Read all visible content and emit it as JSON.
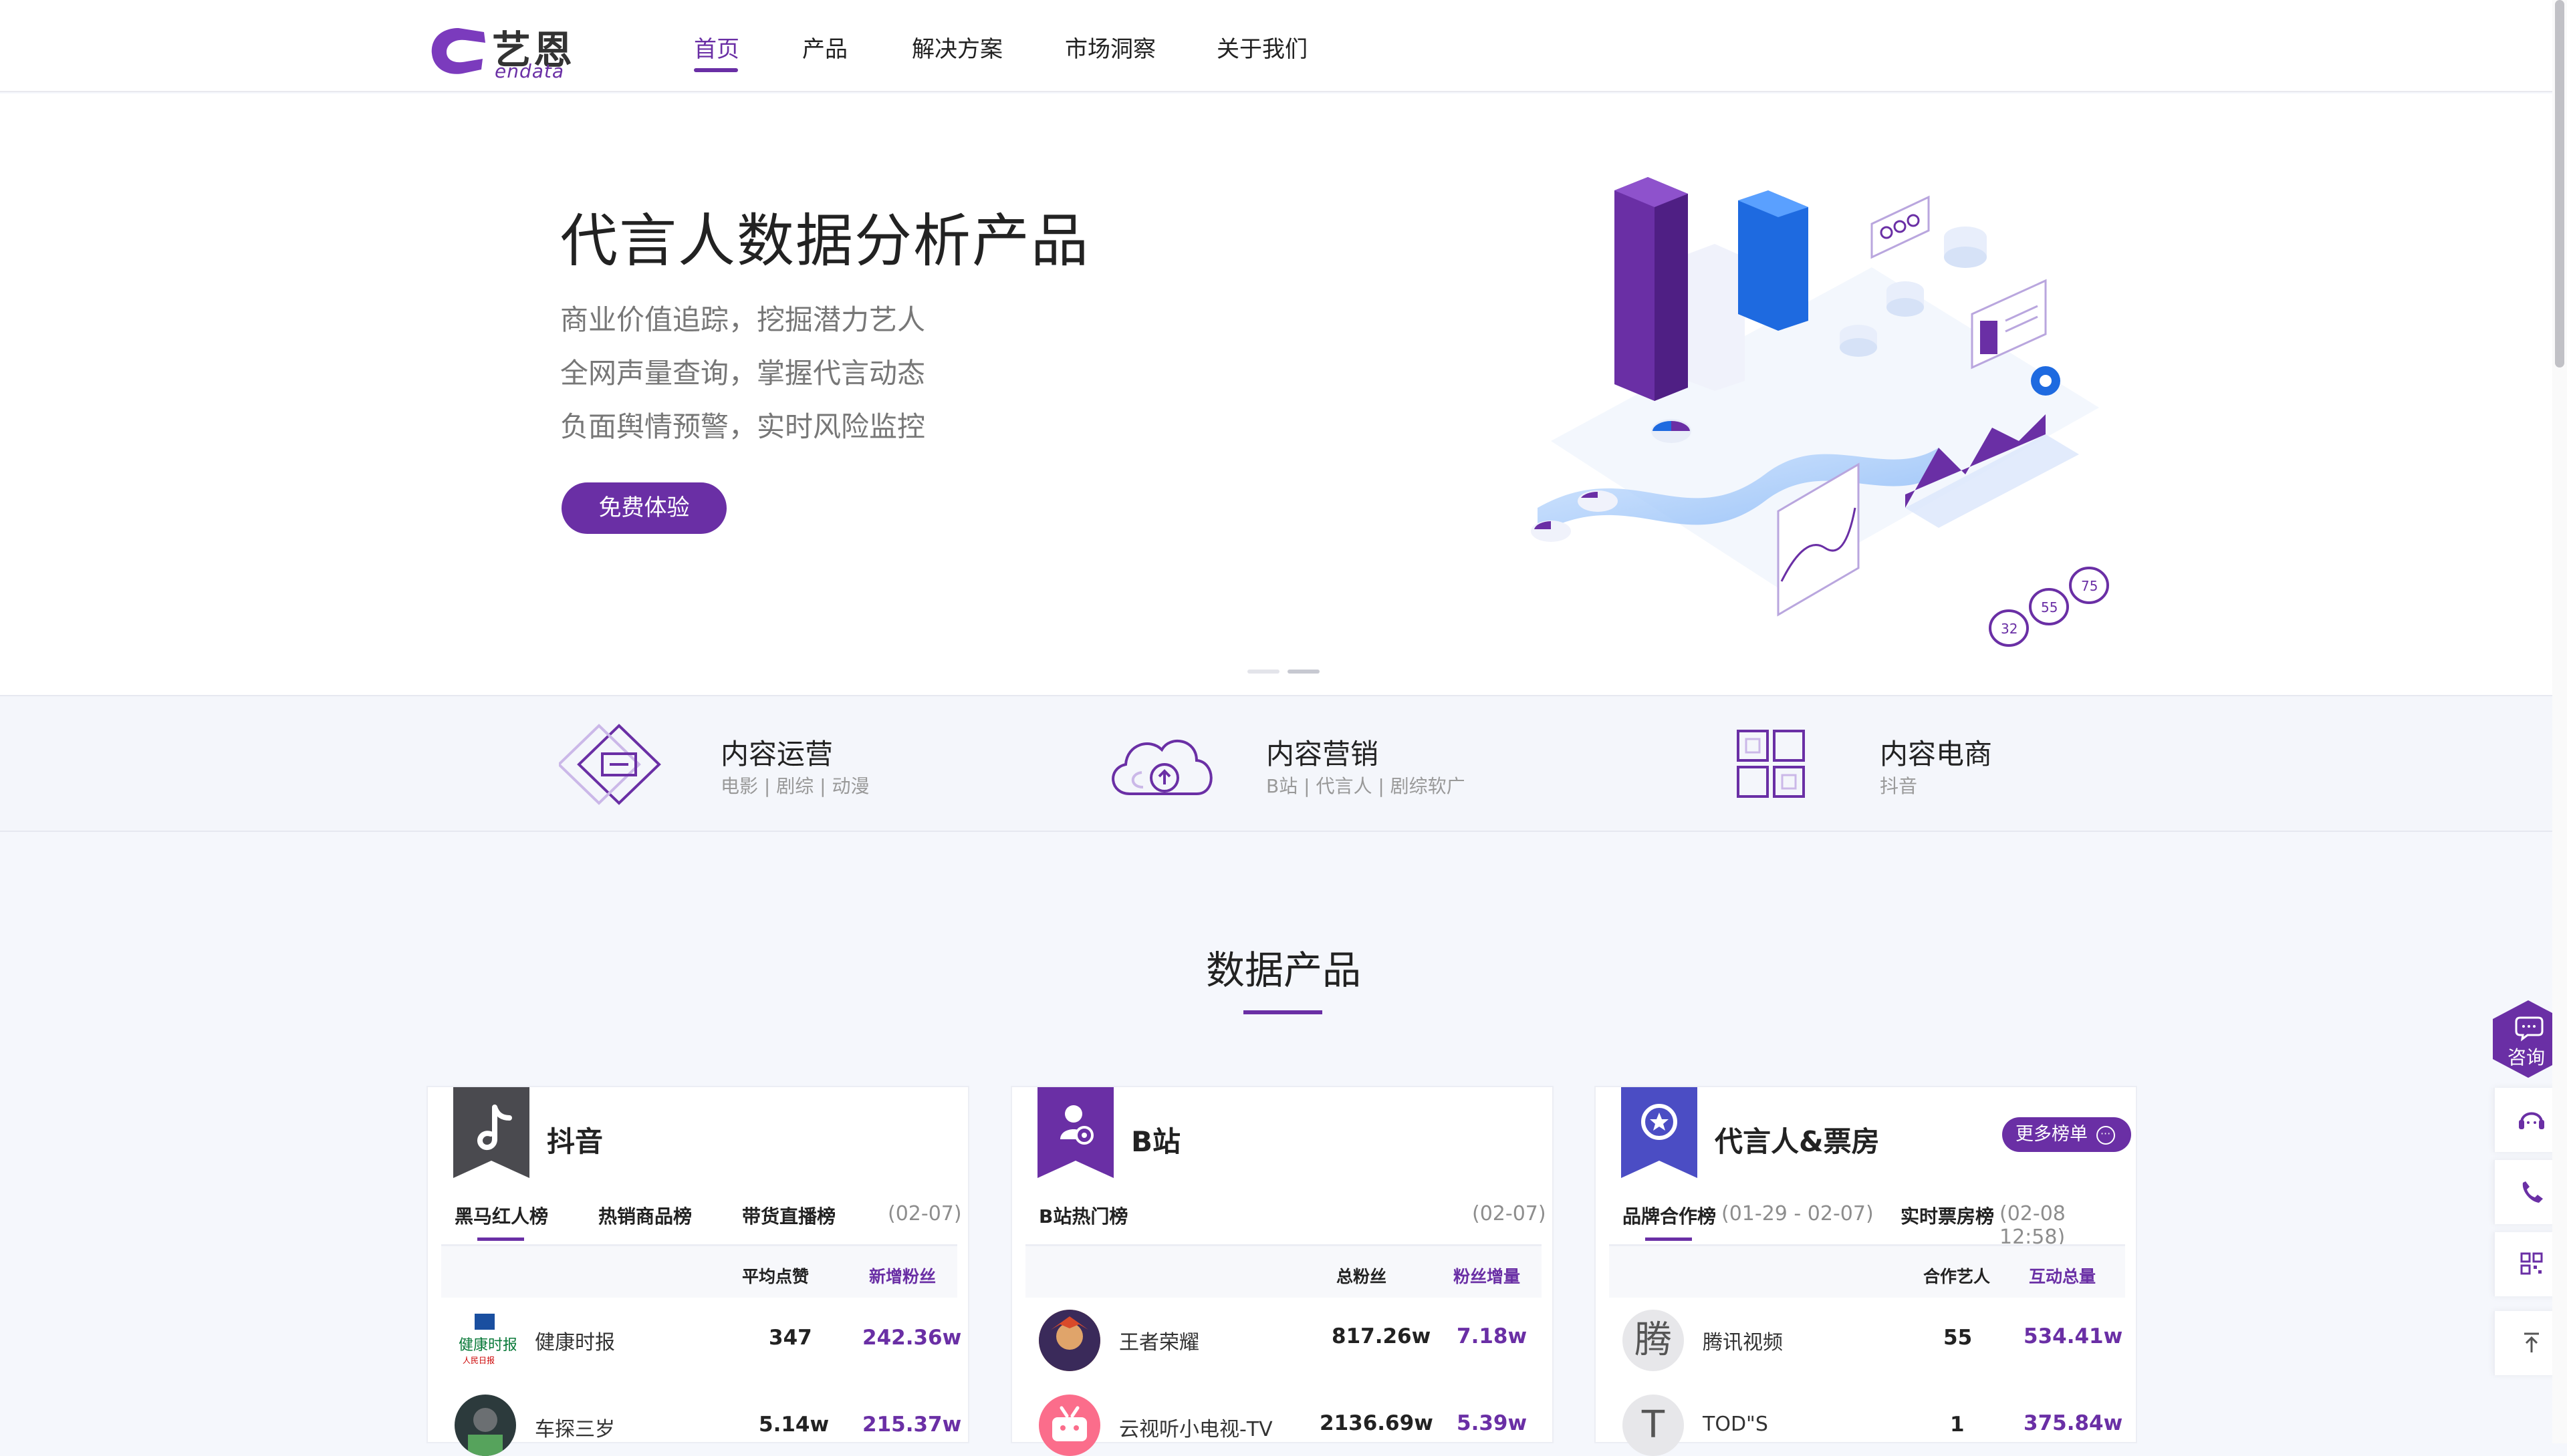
{
  "brand": {
    "cn": "艺恩",
    "en": "endata",
    "color": "#6a2fa5"
  },
  "nav": [
    "首页",
    "产品",
    "解决方案",
    "市场洞察",
    "关于我们"
  ],
  "hero": {
    "title": "代言人数据分析产品",
    "lines": [
      "商业价值追踪，挖掘潜力艺人",
      "全网声量查询，掌握代言动态",
      "负面舆情预警，实时风险监控"
    ],
    "cta": "免费体验",
    "badges": [
      "32",
      "55",
      "75"
    ]
  },
  "categories": [
    {
      "title": "内容运营",
      "sub": "电影 | 剧综 | 动漫",
      "icon": "diamond-screen-icon"
    },
    {
      "title": "内容营销",
      "sub": "B站 | 代言人 | 剧综软广",
      "icon": "cloud-upload-icon"
    },
    {
      "title": "内容电商",
      "sub": "抖音",
      "icon": "grid-boxes-icon"
    }
  ],
  "section_title": "数据产品",
  "cards": [
    {
      "title": "抖音",
      "icon": "tiktok-icon",
      "tabs": [
        {
          "label": "黑马红人榜",
          "active": true
        },
        {
          "label": "热销商品榜"
        },
        {
          "label": "带货直播榜"
        }
      ],
      "date": "(02-07)",
      "col1": "平均点赞",
      "col2": "新增粉丝",
      "rows": [
        {
          "name": "健康时报",
          "v1": "347",
          "v2": "242.36w"
        },
        {
          "name": "车探三岁",
          "v1": "5.14w",
          "v2": "215.37w"
        }
      ]
    },
    {
      "title": "B站",
      "icon": "bilibili-user-icon",
      "tabs": [
        {
          "label": "B站热门榜",
          "active": true
        }
      ],
      "date": "(02-07)",
      "col1": "总粉丝",
      "col2": "粉丝增量",
      "rows": [
        {
          "name": "王者荣耀",
          "v1": "817.26w",
          "v2": "7.18w"
        },
        {
          "name": "云视听小电视-TV",
          "v1": "2136.69w",
          "v2": "5.39w"
        }
      ]
    },
    {
      "title": "代言人&票房",
      "icon": "star-badge-icon",
      "more": "更多榜单",
      "tabs": [
        {
          "label": "品牌合作榜",
          "date": "(01-29 - 02-07)",
          "active": true
        },
        {
          "label": "实时票房榜",
          "date": "(02-08 12:58)"
        }
      ],
      "col1": "合作艺人",
      "col2": "互动总量",
      "rows": [
        {
          "name": "腾讯视频",
          "avatar": "腾",
          "v1": "55",
          "v2": "534.41w"
        },
        {
          "name": "TOD\"S",
          "avatar": "T",
          "v1": "1",
          "v2": "375.84w"
        }
      ]
    }
  ],
  "side": {
    "consult": "咨询"
  }
}
